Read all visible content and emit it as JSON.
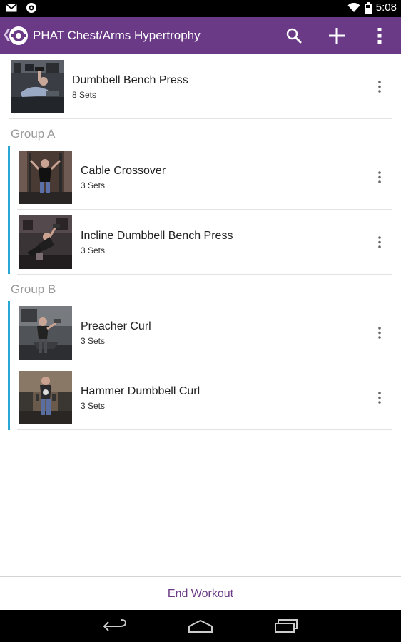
{
  "status_bar": {
    "time": "5:08",
    "icons": [
      "gmail-icon",
      "app-notification-icon",
      "wifi-icon",
      "battery-icon"
    ]
  },
  "action_bar": {
    "title": "PHAT Chest/Arms Hypertrophy",
    "up_glyph": "❮",
    "icons": [
      "app-logo-icon",
      "search-icon",
      "add-icon",
      "overflow-menu-icon"
    ],
    "color": "#6a3a86"
  },
  "exercises": {
    "single": {
      "name": "Dumbbell Bench Press",
      "sets": "8 Sets"
    },
    "group_a": {
      "label": "Group A",
      "items": [
        {
          "name": "Cable Crossover",
          "sets": "3 Sets"
        },
        {
          "name": "Incline Dumbbell Bench Press",
          "sets": "3 Sets"
        }
      ]
    },
    "group_b": {
      "label": "Group B",
      "items": [
        {
          "name": "Preacher Curl",
          "sets": "3 Sets"
        },
        {
          "name": "Hammer Dumbbell Curl",
          "sets": "3 Sets"
        }
      ]
    }
  },
  "footer": {
    "end_workout_label": "End Workout"
  },
  "colors": {
    "accent": "#6a3a86",
    "group_bar": "#2aa8d5",
    "group_label": "#9a9a9a"
  }
}
